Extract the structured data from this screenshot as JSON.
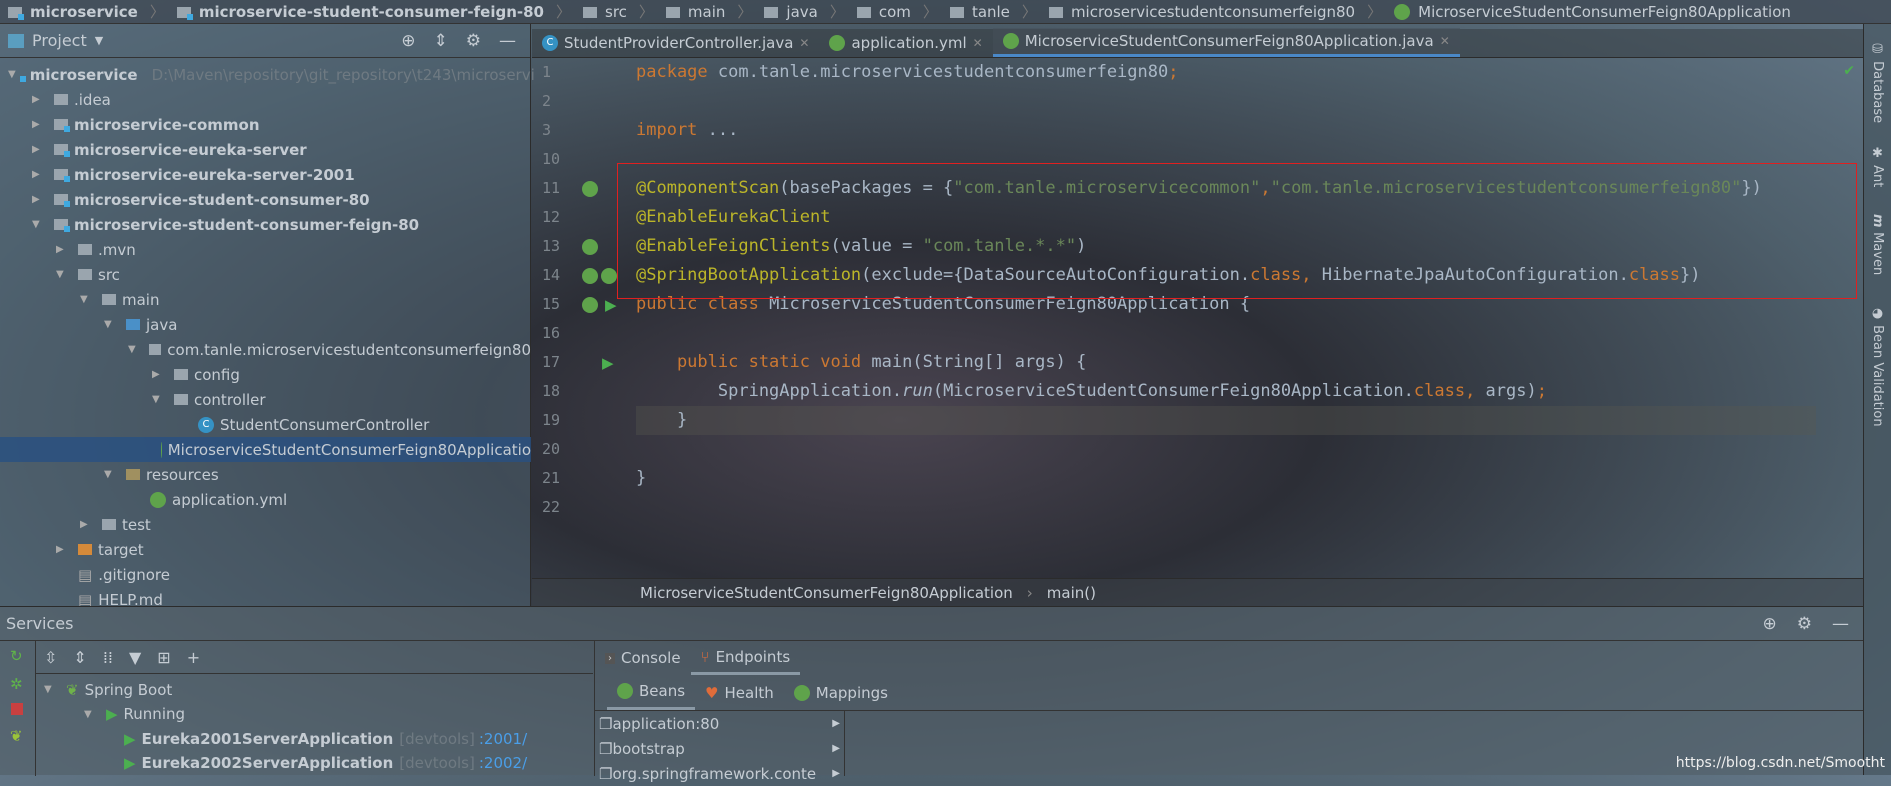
{
  "breadcrumb": [
    "microservice",
    "microservice-student-consumer-feign-80",
    "src",
    "main",
    "java",
    "com",
    "tanle",
    "microservicestudentconsumerfeign80",
    "MicroserviceStudentConsumerFeign80Application"
  ],
  "project": {
    "title": "Project",
    "tree": [
      {
        "label": "microservice",
        "path": "D:\\Maven\\repository\\git_repository\\t243\\microservi",
        "depth": 0,
        "expanded": true,
        "bold": true,
        "type": "module"
      },
      {
        "label": ".idea",
        "depth": 1,
        "expanded": false,
        "type": "folder"
      },
      {
        "label": "microservice-common",
        "depth": 1,
        "expanded": false,
        "bold": true,
        "type": "module"
      },
      {
        "label": "microservice-eureka-server",
        "depth": 1,
        "expanded": false,
        "bold": true,
        "type": "module"
      },
      {
        "label": "microservice-eureka-server-2001",
        "depth": 1,
        "expanded": false,
        "bold": true,
        "type": "module"
      },
      {
        "label": "microservice-student-consumer-80",
        "depth": 1,
        "expanded": false,
        "bold": true,
        "type": "module"
      },
      {
        "label": "microservice-student-consumer-feign-80",
        "depth": 1,
        "expanded": true,
        "bold": true,
        "type": "module"
      },
      {
        "label": ".mvn",
        "depth": 2,
        "expanded": false,
        "type": "folder"
      },
      {
        "label": "src",
        "depth": 2,
        "expanded": true,
        "type": "folder"
      },
      {
        "label": "main",
        "depth": 3,
        "expanded": true,
        "type": "folder"
      },
      {
        "label": "java",
        "depth": 4,
        "expanded": true,
        "type": "folder"
      },
      {
        "label": "com.tanle.microservicestudentconsumerfeign80",
        "depth": 5,
        "expanded": true,
        "type": "package"
      },
      {
        "label": "config",
        "depth": 6,
        "expanded": false,
        "type": "package"
      },
      {
        "label": "controller",
        "depth": 6,
        "expanded": true,
        "type": "package"
      },
      {
        "label": "StudentConsumerController",
        "depth": 7,
        "type": "class"
      },
      {
        "label": "MicroserviceStudentConsumerFeign80Applicatio",
        "depth": 6,
        "type": "springclass",
        "selected": true
      },
      {
        "label": "resources",
        "depth": 4,
        "expanded": true,
        "type": "folder"
      },
      {
        "label": "application.yml",
        "depth": 5,
        "type": "yml"
      },
      {
        "label": "test",
        "depth": 3,
        "expanded": false,
        "type": "folder"
      },
      {
        "label": "target",
        "depth": 2,
        "expanded": false,
        "type": "folder-orange"
      },
      {
        "label": ".gitignore",
        "depth": 2,
        "type": "file"
      },
      {
        "label": "HELP.md",
        "depth": 2,
        "type": "file"
      }
    ]
  },
  "tabs": [
    {
      "label": "StudentProviderController.java",
      "icon": "class-icon"
    },
    {
      "label": "application.yml",
      "icon": "spring-yml-icon"
    },
    {
      "label": "MicroserviceStudentConsumerFeign80Application.java",
      "icon": "spring-class-icon",
      "active": true
    }
  ],
  "code": [
    {
      "n": "1",
      "t": [
        [
          "kw",
          "package "
        ],
        [
          "",
          "com.tanle.microservicestudentconsumerfeign80"
        ],
        [
          "kw",
          ";"
        ]
      ]
    },
    {
      "n": "2",
      "t": []
    },
    {
      "n": "3",
      "t": [
        [
          "kw",
          "import "
        ],
        [
          "",
          "..."
        ]
      ]
    },
    {
      "n": "10",
      "t": []
    },
    {
      "n": "11",
      "t": [
        [
          "an",
          "@ComponentScan"
        ],
        [
          "",
          "(basePackages = {"
        ],
        [
          "st",
          "\"com.tanle.microservicecommon\""
        ],
        [
          "kw",
          ","
        ],
        [
          "st",
          "\"com.tanle.microservicestudentconsumerfeign80\""
        ],
        [
          "",
          "})"
        ]
      ]
    },
    {
      "n": "12",
      "t": [
        [
          "an",
          "@EnableEurekaClient"
        ]
      ]
    },
    {
      "n": "13",
      "t": [
        [
          "an",
          "@EnableFeignClients"
        ],
        [
          "",
          "(value = "
        ],
        [
          "st",
          "\"com.tanle.*.*\""
        ],
        [
          "",
          ")"
        ]
      ]
    },
    {
      "n": "14",
      "t": [
        [
          "an",
          "@SpringBootApplication"
        ],
        [
          "",
          "(exclude={DataSourceAutoConfiguration."
        ],
        [
          "kw",
          "class"
        ],
        [
          "kw",
          ", "
        ],
        [
          "",
          "HibernateJpaAutoConfiguration."
        ],
        [
          "kw",
          "class"
        ],
        [
          "",
          "})"
        ]
      ]
    },
    {
      "n": "15",
      "t": [
        [
          "kw",
          "public class "
        ],
        [
          "",
          "MicroserviceStudentConsumerFeign80Application {"
        ]
      ]
    },
    {
      "n": "16",
      "t": []
    },
    {
      "n": "17",
      "t": [
        [
          "kw",
          "    public static void "
        ],
        [
          "",
          "main(String[] args) {"
        ]
      ]
    },
    {
      "n": "18",
      "t": [
        [
          "",
          "        SpringApplication."
        ],
        [
          "it",
          "run"
        ],
        [
          "",
          "(MicroserviceStudentConsumerFeign80Application."
        ],
        [
          "kw",
          "class"
        ],
        [
          "kw",
          ", "
        ],
        [
          "",
          "args)"
        ],
        [
          "kw",
          ";"
        ]
      ]
    },
    {
      "n": "19",
      "t": [
        [
          "",
          "    }"
        ]
      ]
    },
    {
      "n": "20",
      "t": []
    },
    {
      "n": "21",
      "t": [
        [
          "",
          "}"
        ]
      ]
    },
    {
      "n": "22",
      "t": []
    }
  ],
  "editor_breadcrumb": [
    "MicroserviceStudentConsumerFeign80Application",
    "main()"
  ],
  "right_sidebar": [
    "Database",
    "Ant",
    "Maven",
    "Bean Validation"
  ],
  "services": {
    "title": "Services",
    "tree": [
      {
        "label": "Spring Boot",
        "depth": 0
      },
      {
        "label": "Running",
        "depth": 1
      },
      {
        "label": "Eureka2001ServerApplication",
        "tag": "[devtools]",
        "port": ":2001/",
        "depth": 2
      },
      {
        "label": "Eureka2002ServerApplication",
        "tag": "[devtools]",
        "port": ":2002/",
        "depth": 2
      }
    ],
    "tabs": [
      "Console",
      "Endpoints"
    ],
    "active_tab": "Endpoints",
    "subtabs": [
      "Beans",
      "Health",
      "Mappings"
    ],
    "active_subtab": "Beans",
    "beans": [
      "application:80",
      "bootstrap",
      "org.springframework.conte"
    ]
  },
  "watermark": "https://blog.csdn.net/Smootht",
  "colors": {
    "keyword": "#cc7832",
    "annotation": "#bbb529",
    "string": "#6a8759",
    "text": "#a9b7c6",
    "highlight_box": "#e02020",
    "accent": "#4a88c7"
  }
}
